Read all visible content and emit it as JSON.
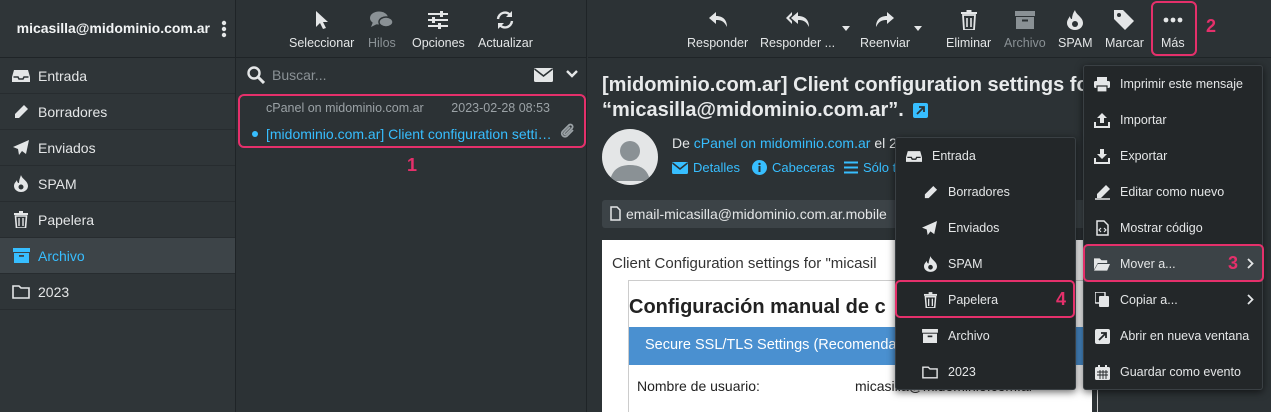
{
  "account": {
    "email": "micasilla@midominio.com.ar"
  },
  "folders": [
    {
      "label": "Entrada",
      "icon": "inbox-icon"
    },
    {
      "label": "Borradores",
      "icon": "pencil-icon"
    },
    {
      "label": "Enviados",
      "icon": "paper-plane-icon"
    },
    {
      "label": "SPAM",
      "icon": "fire-icon"
    },
    {
      "label": "Papelera",
      "icon": "trash-icon"
    },
    {
      "label": "Archivo",
      "icon": "archive-icon",
      "selected": true
    },
    {
      "label": "2023",
      "icon": "folder-icon"
    }
  ],
  "list_toolbar": {
    "select": "Seleccionar",
    "threads": "Hilos",
    "options": "Opciones",
    "refresh": "Actualizar"
  },
  "search": {
    "placeholder": "Buscar..."
  },
  "message": {
    "from": "cPanel on midominio.com.ar",
    "date": "2023-02-28 08:53",
    "subject": "[midominio.com.ar] Client configuration settings for \"micasilla@midominio.com.ar\"."
  },
  "steps": {
    "s1": "1",
    "s2": "2",
    "s3": "3",
    "s4": "4"
  },
  "message_toolbar": {
    "reply": "Responder",
    "reply_all": "Responder ...",
    "forward": "Reenviar",
    "delete": "Eliminar",
    "archive": "Archivo",
    "spam": "SPAM",
    "mark": "Marcar",
    "more": "Más"
  },
  "view": {
    "subject_line1": "[midominio.com.ar] Client configuration settings fo",
    "subject_line2": "“micasilla@midominio.com.ar”.",
    "from_prefix": "De ",
    "from_name": "cPanel on midominio.com.ar",
    "from_suffix": " el 2",
    "details": "Detalles",
    "headers": "Cabeceras",
    "plain": "Sólo t",
    "attachment": "email-micasilla@midominio.com.ar.mobile",
    "body_intro": "Client Configuration settings for \"micasil",
    "body_heading": "Configuración manual de c",
    "body_blue": "Secure SSL/TLS Settings (Recomendado",
    "body_user_label": "Nombre de usuario:",
    "body_user_value": "micasilla@midominio.com.ar"
  },
  "more_menu": [
    {
      "label": "Imprimir este mensaje",
      "icon": "print-icon"
    },
    {
      "label": "Importar",
      "icon": "upload-icon"
    },
    {
      "label": "Exportar",
      "icon": "download-icon"
    },
    {
      "label": "Editar como nuevo",
      "icon": "edit-icon"
    },
    {
      "label": "Mostrar código",
      "icon": "code-file-icon"
    },
    {
      "label": "Mover a...",
      "icon": "folder-open-icon",
      "highlighted": true
    },
    {
      "label": "Copiar a...",
      "icon": "copy-icon"
    },
    {
      "label": "Abrir en nueva ventana",
      "icon": "external-window-icon"
    },
    {
      "label": "Guardar como evento",
      "icon": "calendar-icon"
    }
  ],
  "move_menu": [
    {
      "label": "Entrada",
      "icon": "inbox-icon"
    },
    {
      "label": "Borradores",
      "icon": "pencil-icon"
    },
    {
      "label": "Enviados",
      "icon": "paper-plane-icon"
    },
    {
      "label": "SPAM",
      "icon": "fire-icon"
    },
    {
      "label": "Papelera",
      "icon": "trash-icon",
      "highlighted": true
    },
    {
      "label": "Archivo",
      "icon": "archive-icon"
    },
    {
      "label": "2023",
      "icon": "folder-icon"
    }
  ],
  "colors": {
    "accent": "#37beff",
    "highlight": "#e5306b",
    "background": "#2c3235"
  }
}
